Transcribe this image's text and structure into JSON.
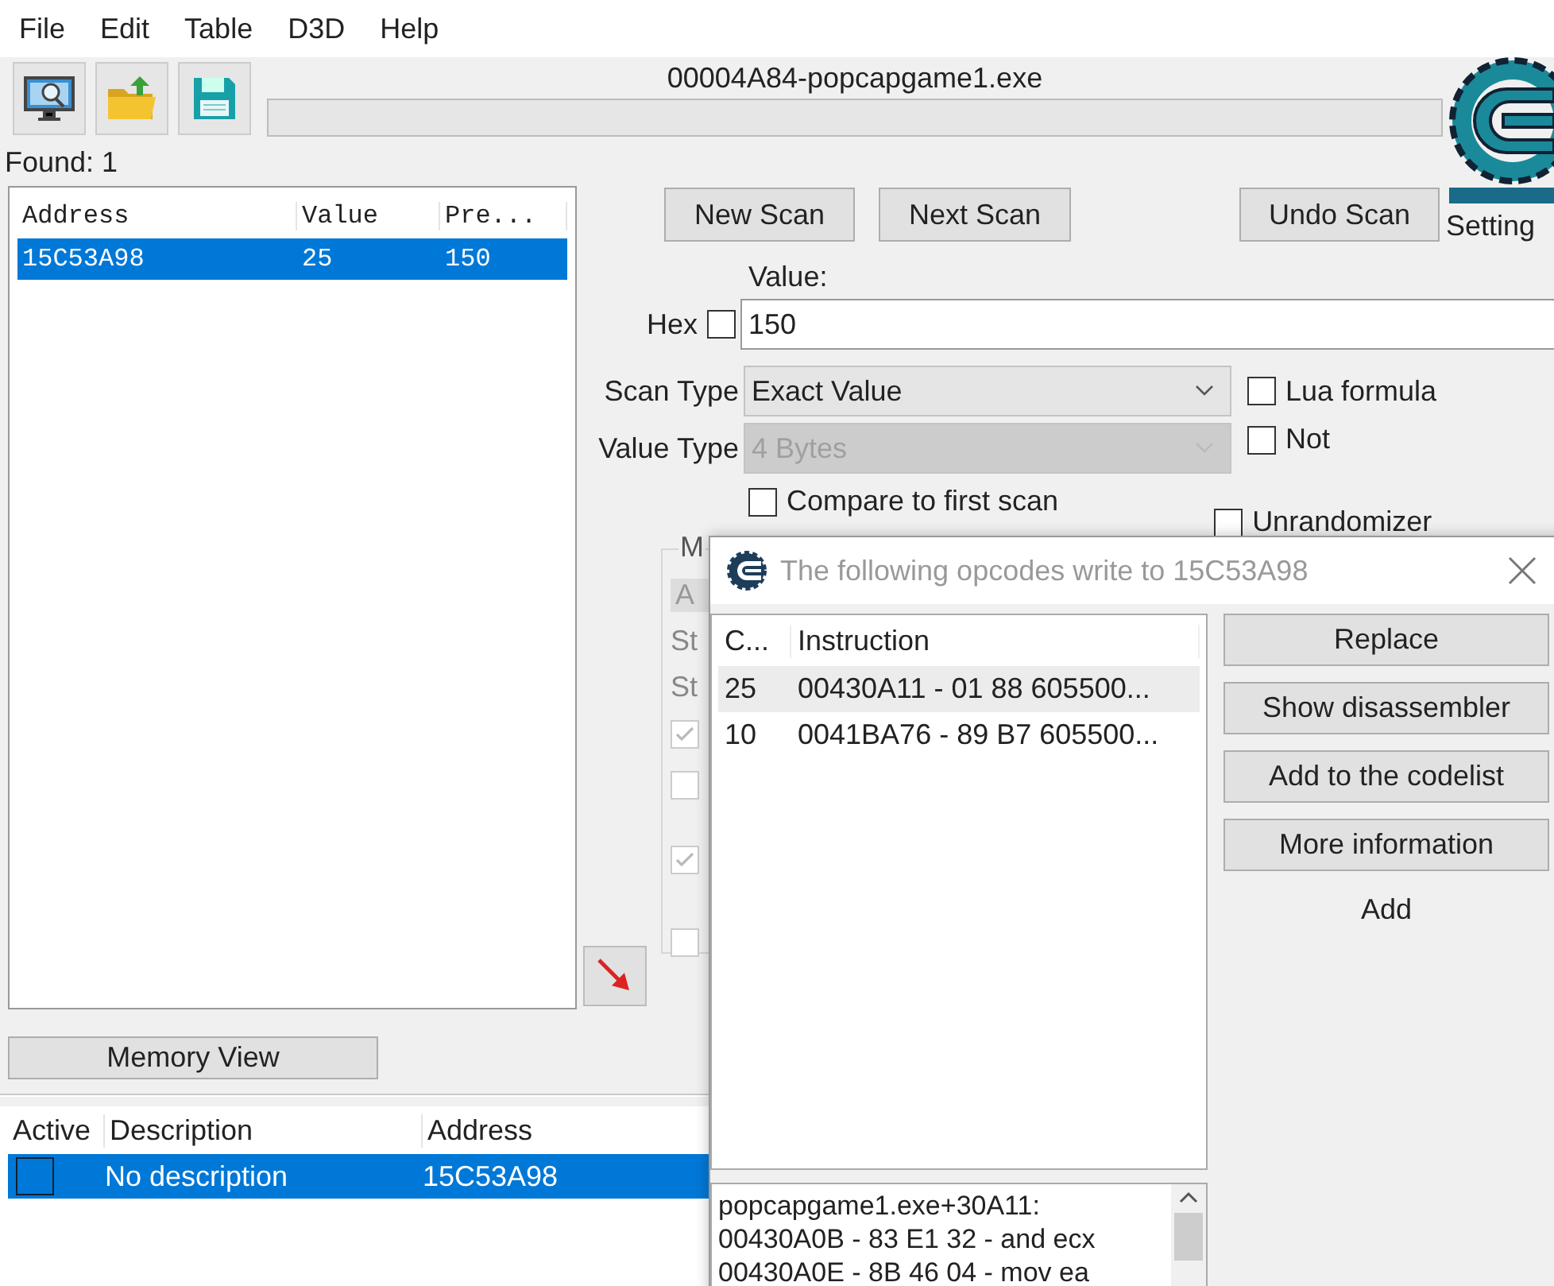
{
  "menu": [
    "File",
    "Edit",
    "Table",
    "D3D",
    "Help"
  ],
  "process_title": "00004A84-popcapgame1.exe",
  "progress": {
    "level": 0
  },
  "found_label": "Found: 1",
  "logo_caption": "Setting",
  "found_list": {
    "columns": [
      "Address",
      "Value",
      "Pre..."
    ],
    "rows": [
      {
        "cells": [
          "15C53A98",
          "25",
          "150"
        ],
        "selected": true
      }
    ]
  },
  "scan_buttons": [
    "New Scan",
    "Next Scan",
    "Undo Scan"
  ],
  "value_label": "Value:",
  "hex": {
    "label": "Hex",
    "checked": false
  },
  "value_input": "150",
  "scan_type": {
    "label": "Scan Type",
    "value": "Exact Value",
    "disabled": false
  },
  "value_type": {
    "label": "Value Type",
    "value": "4 Bytes",
    "disabled": true
  },
  "options": [
    {
      "label": "Lua formula",
      "checked": false
    },
    {
      "label": "Not",
      "checked": false
    }
  ],
  "compare_first": {
    "label": "Compare to first scan",
    "checked": false
  },
  "unrandomizer": {
    "label": "Unrandomizer",
    "checked": false
  },
  "memory_options": {
    "title": "M",
    "button": "A",
    "labels": [
      "St",
      "St"
    ],
    "checkboxes": [
      {
        "checked": true
      },
      {
        "checked": false
      },
      {
        "checked": true
      },
      {
        "checked": false
      }
    ]
  },
  "memory_view_button": "Memory View",
  "cheat_table": {
    "columns": [
      "Active",
      "Description",
      "Address"
    ],
    "rows": [
      {
        "active": false,
        "description": "No description",
        "address": "15C53A98",
        "selected": true
      }
    ]
  },
  "dialog": {
    "title": "The following opcodes write to 15C53A98",
    "columns": [
      "C...",
      "Instruction"
    ],
    "rows": [
      {
        "count": "25",
        "instruction": "00430A11 - 01 88 605500...",
        "selected": true
      },
      {
        "count": "10",
        "instruction": "0041BA76 - 89 B7 605500...",
        "selected": false
      }
    ],
    "buttons": [
      "Replace",
      "Show disassembler",
      "Add to the codelist",
      "More information"
    ],
    "add_label": "Add",
    "details": [
      "popcapgame1.exe+30A11:",
      "00430A0B - 83 E1 32 - and ecx",
      "00430A0E - 8B 46 04 - mov ea"
    ]
  }
}
